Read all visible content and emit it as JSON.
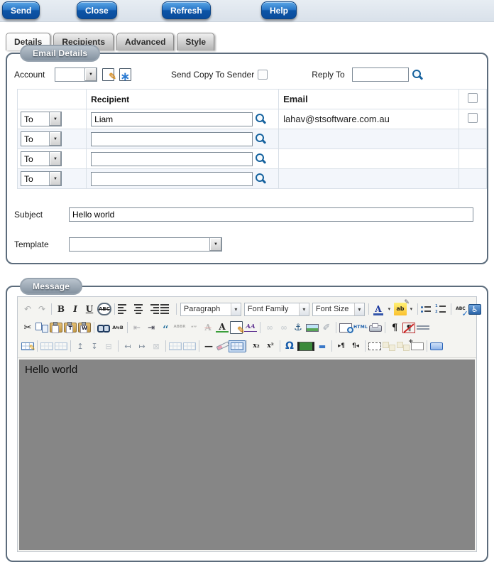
{
  "topbar": {
    "buttons": [
      {
        "id": "send-button",
        "label": "Send"
      },
      {
        "id": "close-button",
        "label": "Close"
      },
      {
        "id": "refresh-button",
        "label": "Refresh"
      },
      {
        "id": "help-button",
        "label": "Help"
      }
    ]
  },
  "tabs": [
    {
      "id": "tab-details",
      "label": "Details",
      "active": true
    },
    {
      "id": "tab-recipients",
      "label": "Recipients",
      "active": false
    },
    {
      "id": "tab-advanced",
      "label": "Advanced",
      "active": false
    },
    {
      "id": "tab-style",
      "label": "Style",
      "active": false
    }
  ],
  "email_details": {
    "legend": "Email Details",
    "account_label": "Account",
    "account_value": "",
    "send_copy_label": "Send Copy To Sender",
    "send_copy_checked": false,
    "reply_to_label": "Reply To",
    "reply_to_value": "",
    "recipients_table": {
      "recipient_header": "Recipient",
      "email_header": "Email",
      "rows": [
        {
          "type": "To",
          "recipient": "Liam",
          "email": "lahav@stsoftware.com.au",
          "has_checkbox": true
        },
        {
          "type": "To",
          "recipient": "",
          "email": "",
          "has_checkbox": false
        },
        {
          "type": "To",
          "recipient": "",
          "email": "",
          "has_checkbox": false
        },
        {
          "type": "To",
          "recipient": "",
          "email": "",
          "has_checkbox": false
        }
      ]
    },
    "subject_label": "Subject",
    "subject_value": "Hello world",
    "template_label": "Template",
    "template_value": ""
  },
  "message": {
    "legend": "Message",
    "body_text": "Hello world",
    "toolbar": {
      "rows": [
        [
          {
            "n": "undo-icon",
            "g": "↶",
            "d": 1
          },
          {
            "n": "redo-icon",
            "g": "↷",
            "d": 1
          },
          {
            "sep": 1
          },
          {
            "n": "bold-icon",
            "g": "B",
            "k": "fb"
          },
          {
            "n": "italic-icon",
            "g": "I",
            "k": "fi"
          },
          {
            "n": "underline-icon",
            "g": "U",
            "k": "fu"
          },
          {
            "n": "strikethrough-icon",
            "g": "ABC",
            "k": "fs"
          },
          {
            "sep": 1
          },
          {
            "n": "align-left-icon",
            "kind": "bars"
          },
          {
            "n": "align-center-icon",
            "kind": "bars bars-c"
          },
          {
            "n": "align-right-icon",
            "kind": "bars bars-r"
          },
          {
            "n": "align-justify-icon",
            "kind": "bars bars-j"
          },
          {
            "sep": 1
          },
          {
            "n": "paragraph-select",
            "sel": "Paragraph",
            "w": 86
          },
          {
            "n": "font-family-select",
            "sel": "Font Family",
            "w": 92
          },
          {
            "n": "font-size-select",
            "sel": "Font Size",
            "w": 74
          },
          {
            "sep": 1
          },
          {
            "n": "forecolor-icon",
            "g": "A",
            "k": "fore"
          },
          {
            "n": "forecolor-arrow-icon",
            "g": "▾",
            "k": "dd"
          },
          {
            "n": "backcolor-icon",
            "g": "ab",
            "k": "back"
          },
          {
            "n": "backcolor-arrow-icon",
            "g": "▾",
            "k": "dd"
          },
          {
            "sep": 1
          },
          {
            "n": "bullet-list-icon",
            "kind": "ulist"
          },
          {
            "n": "numbered-list-icon",
            "kind": "olist"
          },
          {
            "sep": 1
          },
          {
            "n": "spellcheck-icon",
            "g": "ABC",
            "k": "spell"
          },
          {
            "n": "accessibility-check-icon",
            "g": "♿",
            "k": "a11y"
          }
        ],
        [
          {
            "n": "cut-icon",
            "g": "✂",
            "k": "cut"
          },
          {
            "n": "copy-icon",
            "kind": "copy2"
          },
          {
            "n": "paste-icon",
            "kind": "clip",
            "t": ""
          },
          {
            "n": "paste-text-icon",
            "kind": "clip",
            "t": "T"
          },
          {
            "n": "paste-word-icon",
            "kind": "clip",
            "t": "W"
          },
          {
            "sep": 1
          },
          {
            "n": "find-icon",
            "kind": "bino"
          },
          {
            "n": "find-replace-icon",
            "g": "A⇆B",
            "k": "tiny"
          },
          {
            "sep": 1
          },
          {
            "n": "outdent-icon",
            "g": "⇤",
            "k": "ind",
            "d": 1
          },
          {
            "n": "indent-icon",
            "g": "⇥",
            "k": "ind"
          },
          {
            "n": "blockquote-icon",
            "g": "“",
            "k": "quote"
          },
          {
            "n": "abbr-icon",
            "g": "ABBR",
            "k": "abbr",
            "d": 1
          },
          {
            "n": "quotes-icon",
            "g": "“”",
            "k": "tiny",
            "d": 1
          },
          {
            "n": "del-icon",
            "g": "A",
            "k": "del",
            "d": 1
          },
          {
            "n": "ins-icon",
            "g": "A",
            "k": "ins"
          },
          {
            "n": "attributes-icon",
            "kind": "pagepen"
          },
          {
            "n": "style-props-icon",
            "g": "AA",
            "k": "case"
          },
          {
            "sep": 1
          },
          {
            "n": "link-icon",
            "g": "∞",
            "k": "chain",
            "d": 1
          },
          {
            "n": "unlink-icon",
            "g": "∞",
            "k": "chain",
            "d": 1
          },
          {
            "n": "anchor-icon",
            "g": "⚓",
            "k": "anchor"
          },
          {
            "n": "image-icon",
            "kind": "imgic"
          },
          {
            "n": "cleanup-icon",
            "g": "✐",
            "k": "clean"
          },
          {
            "sep": 1
          },
          {
            "n": "preview-icon",
            "kind": "pagemag"
          },
          {
            "n": "html-icon",
            "g": "HTML",
            "k": "html"
          },
          {
            "n": "print-icon",
            "kind": "printer"
          },
          {
            "sep": 1
          },
          {
            "n": "show-blocks-icon",
            "g": "¶",
            "k": "pil"
          },
          {
            "n": "visual-chars-icon",
            "g": "¶",
            "k": "pilx"
          },
          {
            "n": "page-break-icon",
            "kind": "pbreak"
          }
        ],
        [
          {
            "n": "insert-table-icon",
            "kind": "tgrid tablepen"
          },
          {
            "sep": 1
          },
          {
            "n": "table-row-props-icon",
            "kind": "tgrid",
            "d": 1
          },
          {
            "n": "table-cell-props-icon",
            "kind": "tgrid",
            "d": 1
          },
          {
            "sep": 1
          },
          {
            "n": "insert-row-before-icon",
            "g": "↥",
            "k": "tbl"
          },
          {
            "n": "insert-row-after-icon",
            "g": "↧",
            "k": "tbl"
          },
          {
            "n": "delete-row-icon",
            "g": "⊟",
            "k": "tbl",
            "d": 1
          },
          {
            "sep": 1
          },
          {
            "n": "insert-col-before-icon",
            "g": "↤",
            "k": "tbl"
          },
          {
            "n": "insert-col-after-icon",
            "g": "↦",
            "k": "tbl"
          },
          {
            "n": "delete-col-icon",
            "g": "⊠",
            "k": "tbl",
            "d": 1
          },
          {
            "sep": 1
          },
          {
            "n": "split-cells-icon",
            "kind": "tgrid",
            "d": 1
          },
          {
            "n": "merge-cells-icon",
            "kind": "tgrid",
            "d": 1
          },
          {
            "sep": 1
          },
          {
            "n": "horizontal-rule-icon",
            "g": "—",
            "k": "hr"
          },
          {
            "n": "remove-format-icon",
            "kind": "erase"
          },
          {
            "n": "visual-aid-icon",
            "kind": "tgrid act"
          },
          {
            "sep": 1
          },
          {
            "n": "subscript-icon",
            "g": "x₂",
            "k": "sub"
          },
          {
            "n": "superscript-icon",
            "g": "x²",
            "k": "sub"
          },
          {
            "sep": 1
          },
          {
            "n": "special-char-icon",
            "g": "Ω",
            "k": "omega"
          },
          {
            "n": "media-icon",
            "kind": "film"
          },
          {
            "n": "insert-hr-icon",
            "g": "▬",
            "k": "bluehr"
          },
          {
            "sep": 1
          },
          {
            "n": "ltr-icon",
            "g": "▸¶",
            "k": "dir"
          },
          {
            "n": "rtl-icon",
            "g": "¶◂",
            "k": "dir"
          },
          {
            "sep": 1
          },
          {
            "n": "insert-layer-icon",
            "kind": "dashedbox"
          },
          {
            "n": "move-forward-icon",
            "kind": "layers",
            "d": 1
          },
          {
            "n": "move-backward-icon",
            "kind": "layers",
            "d": 1
          },
          {
            "n": "absolute-position-icon",
            "kind": "absbox"
          },
          {
            "sep": 1
          },
          {
            "n": "fullscreen-icon",
            "kind": "bluebox"
          }
        ]
      ]
    }
  },
  "colors": {
    "button_blue": "#0d55a6",
    "topbar_bg": "#dde4ec",
    "fieldset_border": "#5c6c7c",
    "editor_body_gray": "#868686",
    "accent_blue": "#16629e",
    "row_alt": "#f3f6fb"
  }
}
